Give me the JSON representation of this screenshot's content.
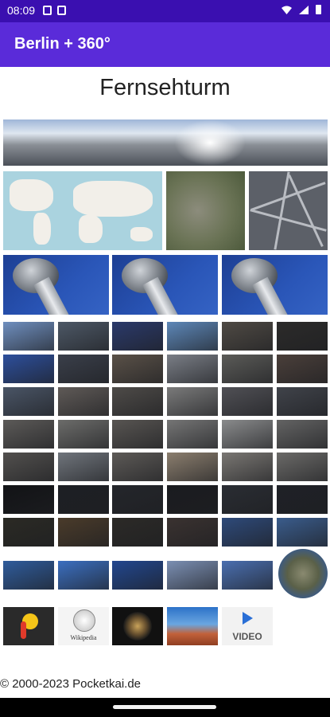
{
  "status_bar": {
    "time": "08:09"
  },
  "app_bar": {
    "title": "Berlin + 360°"
  },
  "page": {
    "title": "Fernsehturm"
  },
  "icons": {
    "wiki_label": "Wikipedia",
    "video_label": "VIDEO"
  },
  "footer": {
    "copyright": "© 2000-2023 Pocketkai.de"
  },
  "thumb_colors": [
    [
      "#6f8fbf",
      "#4d5866",
      "#2b3a6b",
      "#5d87b8",
      "#4f4a44",
      "#2c2b2a"
    ],
    [
      "#2d4f9c",
      "#3a3f4a",
      "#5a5148",
      "#7a7e86",
      "#5b5b58",
      "#4a3f3a"
    ],
    [
      "#4a5566",
      "#5f5a57",
      "#4e4b48",
      "#7a7a7a",
      "#505055",
      "#40434a"
    ],
    [
      "#5c5a58",
      "#6c6c6a",
      "#585552",
      "#757575",
      "#8a8b8c",
      "#636363"
    ],
    [
      "#52504e",
      "#70757c",
      "#5d5a57",
      "#8b7e6e",
      "#7a7773",
      "#6b6a68"
    ],
    [
      "#121316",
      "#1d1f24",
      "#24262b",
      "#1a1b1f",
      "#2a2d33",
      "#1f2127"
    ],
    [
      "#2b2a24",
      "#4a3b2a",
      "#2c2a27",
      "#3a3230",
      "#2e4a7a",
      "#3a5c8c"
    ],
    [
      "#2f5c9c",
      "#3b6fc0",
      "#22478f",
      "#7b8fb3",
      "#4a6fb0",
      ""
    ]
  ]
}
